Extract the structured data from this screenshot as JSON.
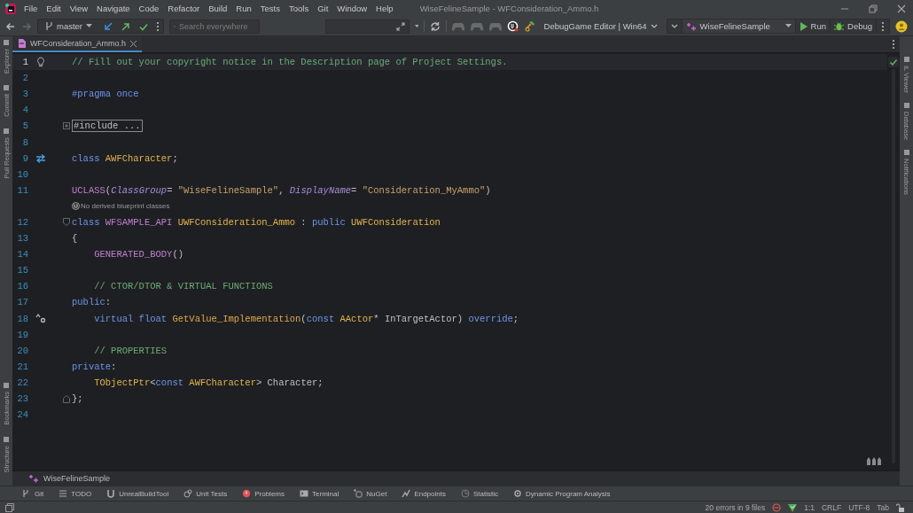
{
  "window": {
    "title": "WiseFelineSample - WFConsideration_Ammo.h"
  },
  "menu": [
    "File",
    "Edit",
    "View",
    "Navigate",
    "Code",
    "Refactor",
    "Build",
    "Run",
    "Tests",
    "Tools",
    "Git",
    "Window",
    "Help"
  ],
  "toolbar": {
    "branch": "master",
    "search": {
      "placeholder": "Search everywhere"
    },
    "configuration": "DebugGame Editor | Win64",
    "run_target": "WiseFelineSample",
    "run": "Run",
    "debug": "Debug"
  },
  "left_strip": {
    "top": [
      "Explorer",
      "Commit",
      "Pull Requests"
    ],
    "bottom": [
      "Bookmarks",
      "Structure"
    ]
  },
  "right_strip": [
    "IL Viewer",
    "Database",
    "Notifications"
  ],
  "tabs": [
    {
      "label": "WFConsideration_Ammo.h",
      "selected": true
    }
  ],
  "editor": {
    "lines": [
      {
        "kind": "code",
        "number": "1",
        "current": true,
        "marker": {
          "kind": "bulb"
        },
        "tokens": [
          {
            "text": "// Fill out your copyright notice in the Description page of Project Settings.",
            "kind": "comment"
          }
        ]
      },
      {
        "kind": "code",
        "number": "2",
        "current": false
      },
      {
        "kind": "code",
        "number": "3",
        "current": false,
        "tokens": [
          {
            "text": "#pragma once",
            "kind": "preproc"
          }
        ]
      },
      {
        "kind": "code",
        "number": "4",
        "current": false
      },
      {
        "kind": "code",
        "number": "5",
        "current": false,
        "fold": {
          "kind": "expand"
        },
        "tokens": [
          {
            "text": "#include ...",
            "kind": "folded"
          }
        ]
      },
      {
        "kind": "code",
        "number": "8",
        "current": false
      },
      {
        "kind": "code",
        "number": "9",
        "current": false,
        "marker": {
          "kind": "related"
        },
        "tokens": [
          {
            "text": "class ",
            "kind": "keyword"
          },
          {
            "text": "AWFCharacter",
            "kind": "type"
          },
          {
            "text": ";",
            "kind": "plain"
          }
        ]
      },
      {
        "kind": "code",
        "number": "10",
        "current": false
      },
      {
        "kind": "code",
        "number": "11",
        "current": false,
        "tokens": [
          {
            "text": "UCLASS",
            "kind": "macro"
          },
          {
            "text": "(",
            "kind": "plain"
          },
          {
            "text": "ClassGroup",
            "kind": "param"
          },
          {
            "text": "= ",
            "kind": "plain"
          },
          {
            "text": "\"WiseFelineSample\"",
            "kind": "string"
          },
          {
            "text": ", ",
            "kind": "plain"
          },
          {
            "text": "DisplayName",
            "kind": "param"
          },
          {
            "text": "= ",
            "kind": "plain"
          },
          {
            "text": "\"Consideration_MyAmmo\"",
            "kind": "string"
          },
          {
            "text": ")",
            "kind": "plain"
          }
        ]
      },
      {
        "kind": "hint",
        "text": "No derived blueprint classes"
      },
      {
        "kind": "code",
        "number": "12",
        "current": false,
        "fold": {
          "kind": "collapse"
        },
        "tokens": [
          {
            "text": "class ",
            "kind": "keyword"
          },
          {
            "text": "WFSAMPLE_API ",
            "kind": "macro"
          },
          {
            "text": "UWFConsideration_Ammo",
            "kind": "type"
          },
          {
            "text": " : ",
            "kind": "plain"
          },
          {
            "text": "public ",
            "kind": "keyword"
          },
          {
            "text": "UWFConsideration",
            "kind": "type"
          }
        ]
      },
      {
        "kind": "code",
        "number": "13",
        "current": false,
        "tokens": [
          {
            "text": "{",
            "kind": "plain"
          }
        ]
      },
      {
        "kind": "code",
        "number": "14",
        "current": false,
        "tokens": [
          {
            "text": "    GENERATED_BODY",
            "kind": "macro"
          },
          {
            "text": "()",
            "kind": "plain"
          }
        ]
      },
      {
        "kind": "code",
        "number": "15",
        "current": false
      },
      {
        "kind": "code",
        "number": "16",
        "current": false,
        "tokens": [
          {
            "text": "    // CTOR/DTOR & VIRTUAL FUNCTIONS",
            "kind": "comment"
          }
        ]
      },
      {
        "kind": "code",
        "number": "17",
        "current": false,
        "tokens": [
          {
            "text": "public",
            "kind": "keyword"
          },
          {
            "text": ":",
            "kind": "plain"
          }
        ]
      },
      {
        "kind": "code",
        "number": "18",
        "current": false,
        "marker": {
          "kind": "override"
        },
        "tokens": [
          {
            "text": "    virtual float ",
            "kind": "keyword"
          },
          {
            "text": "GetValue_Implementation",
            "kind": "func"
          },
          {
            "text": "(",
            "kind": "plain"
          },
          {
            "text": "const ",
            "kind": "keyword"
          },
          {
            "text": "AActor",
            "kind": "type"
          },
          {
            "text": "* InTargetActor) ",
            "kind": "plain"
          },
          {
            "text": "override",
            "kind": "keyword"
          },
          {
            "text": ";",
            "kind": "plain"
          }
        ]
      },
      {
        "kind": "code",
        "number": "19",
        "current": false
      },
      {
        "kind": "code",
        "number": "20",
        "current": false,
        "tokens": [
          {
            "text": "    // PROPERTIES",
            "kind": "comment"
          }
        ]
      },
      {
        "kind": "code",
        "number": "21",
        "current": false,
        "tokens": [
          {
            "text": "private",
            "kind": "keyword"
          },
          {
            "text": ":",
            "kind": "plain"
          }
        ]
      },
      {
        "kind": "code",
        "number": "22",
        "current": false,
        "tokens": [
          {
            "text": "    TObjectPtr",
            "kind": "type"
          },
          {
            "text": "<",
            "kind": "plain"
          },
          {
            "text": "const ",
            "kind": "keyword"
          },
          {
            "text": "AWFCharacter",
            "kind": "type"
          },
          {
            "text": "> Character;",
            "kind": "plain"
          }
        ]
      },
      {
        "kind": "code",
        "number": "23",
        "current": false,
        "fold": {
          "kind": "end"
        },
        "tokens": [
          {
            "text": "};",
            "kind": "plain"
          }
        ]
      },
      {
        "kind": "code",
        "number": "24",
        "current": false
      }
    ]
  },
  "breadcrumb": "WiseFelineSample",
  "tool_windows": [
    {
      "kind": "git",
      "label": "Git"
    },
    {
      "kind": "todo",
      "label": "TODO"
    },
    {
      "kind": "unreal",
      "label": "UnrealBuildTool"
    },
    {
      "kind": "tests",
      "label": "Unit Tests"
    },
    {
      "kind": "problems",
      "label": "Problems"
    },
    {
      "kind": "terminal",
      "label": "Terminal"
    },
    {
      "kind": "nuget",
      "label": "NuGet"
    },
    {
      "kind": "endpoints",
      "label": "Endpoints"
    },
    {
      "kind": "statistic",
      "label": "Statistic"
    },
    {
      "kind": "analysis",
      "label": "Dynamic Program Analysis"
    }
  ],
  "status_bar": {
    "errors": "20 errors in 9 files",
    "position": "1:1",
    "line_ending": "CRLF",
    "encoding": "UTF-8",
    "indent": "Tab"
  }
}
